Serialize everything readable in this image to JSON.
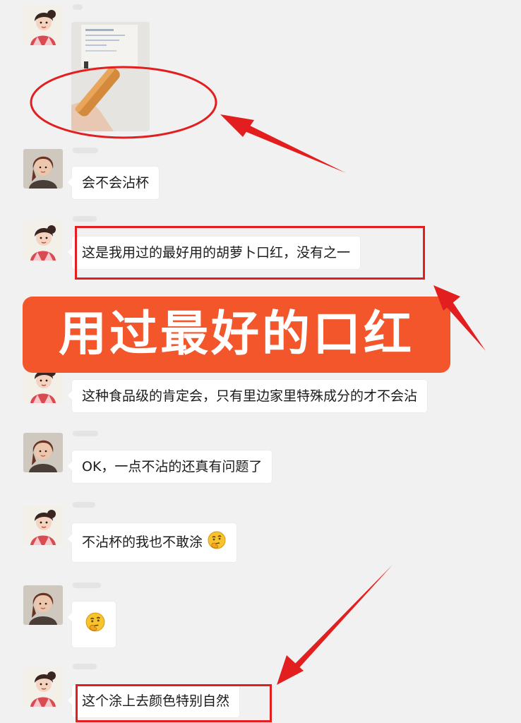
{
  "annotation_color": "#e21e1e",
  "banner": {
    "text": "用过最好的口红",
    "color": "#f2562a"
  },
  "messages": [
    {
      "kind": "image",
      "sender": "female",
      "content": "lipstick-photo"
    },
    {
      "kind": "text",
      "sender": "male",
      "text": "会不会沾杯"
    },
    {
      "kind": "text",
      "sender": "female",
      "text": "这是我用过的最好用的胡萝卜口红，没有之一"
    },
    {
      "kind": "text",
      "sender": "female",
      "text": "这种食品级的肯定会，只有里边家里特殊成分的才不会沾"
    },
    {
      "kind": "text",
      "sender": "male",
      "text": "OK，一点不沾的还真有问题了"
    },
    {
      "kind": "text",
      "sender": "female",
      "text": "不沾杯的我也不敢涂",
      "emoji": "thinking-face"
    },
    {
      "kind": "emoji",
      "sender": "male",
      "emoji": "thinking-face"
    },
    {
      "kind": "text",
      "sender": "female",
      "text": "这个涂上去颜色特别自然"
    }
  ]
}
